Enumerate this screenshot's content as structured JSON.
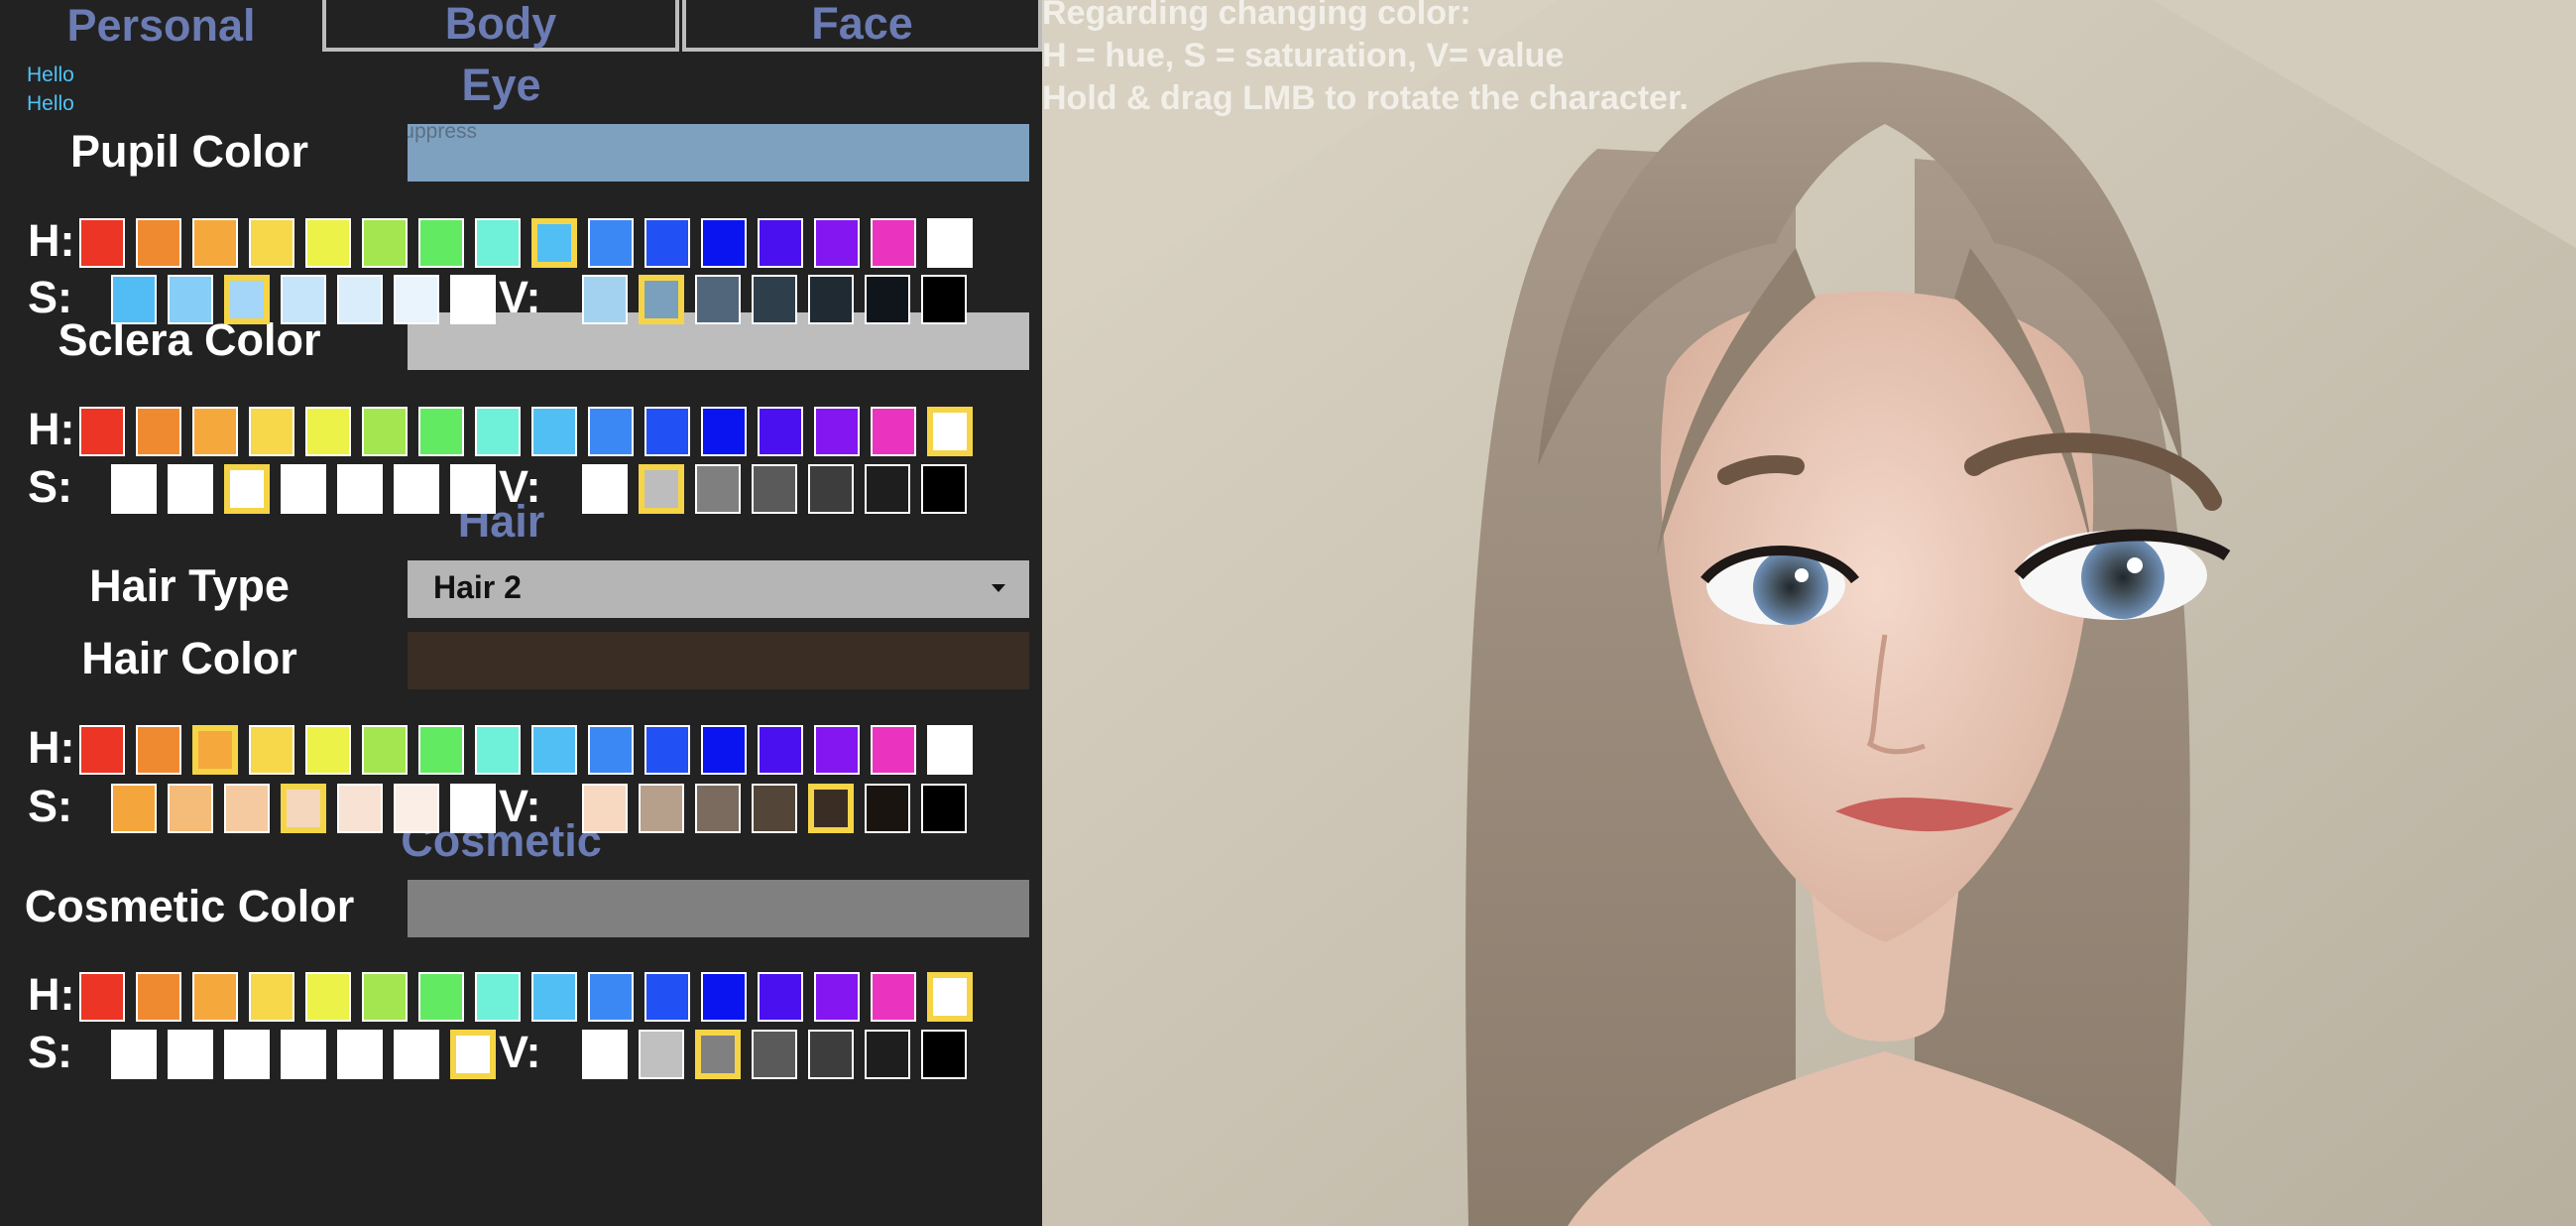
{
  "tabs": {
    "personal": "Personal",
    "body": "Body",
    "face": "Face"
  },
  "debug": {
    "line1": "Hello",
    "line2": "Hello",
    "ghost_text": "Press F to suppress"
  },
  "sections": {
    "eye": "Eye",
    "hair": "Hair",
    "cosmetic": "Cosmetic"
  },
  "labels": {
    "h": "H:",
    "s": "S:",
    "v": "V:"
  },
  "hue_palette": [
    "#ec3524",
    "#f08a30",
    "#f5a93c",
    "#f7d84a",
    "#ecf248",
    "#a4e650",
    "#63ea63",
    "#6ff0d9",
    "#52bff4",
    "#3b88f4",
    "#2150f4",
    "#0a14f0",
    "#4a10f0",
    "#8416f2",
    "#ea34bf",
    "#ffffff"
  ],
  "groups": [
    {
      "key": "pupil",
      "title": "Pupil Color",
      "bar": "#7ea1c0",
      "hue_sel": 8,
      "s": [
        "#52bdf5",
        "#86cdf7",
        "#a3d6f8",
        "#c7e5fa",
        "#d9edfb",
        "#eaf4fd",
        "#ffffff"
      ],
      "s_sel": 2,
      "v": [
        "#a3d2f0",
        "#7ba0bd",
        "#51667a",
        "#2f3e4b",
        "#1f2a33",
        "#0f151a",
        "#000000"
      ],
      "v_sel": 1
    },
    {
      "key": "sclera",
      "title": "Sclera Color",
      "bar": "#bdbdbd",
      "hue_sel": 15,
      "s": [
        "#ffffff",
        "#ffffff",
        "#ffffff",
        "#ffffff",
        "#ffffff",
        "#ffffff",
        "#ffffff"
      ],
      "s_sel": 2,
      "v": [
        "#ffffff",
        "#bdbdbd",
        "#7f7f7f",
        "#5a5a5a",
        "#3d3d3d",
        "#1e1e1e",
        "#000000"
      ],
      "v_sel": 1
    },
    {
      "key": "hair",
      "title": "Hair Color",
      "bar": "#3a2d24",
      "hue_sel": 2,
      "s": [
        "#f4a63c",
        "#f5bb78",
        "#f5caa0",
        "#f5d7bd",
        "#f7e2d3",
        "#faeee6",
        "#ffffff"
      ],
      "s_sel": 3,
      "v": [
        "#f6d9c0",
        "#b6a08b",
        "#7a6b5e",
        "#534638",
        "#3a2d24",
        "#1a1410",
        "#000000"
      ],
      "v_sel": 4
    },
    {
      "key": "cosmetic",
      "title": "Cosmetic Color",
      "bar": "#808080",
      "hue_sel": 15,
      "s": [
        "#ffffff",
        "#ffffff",
        "#ffffff",
        "#ffffff",
        "#ffffff",
        "#ffffff",
        "#ffffff"
      ],
      "s_sel": 6,
      "v": [
        "#ffffff",
        "#c0c0c0",
        "#808080",
        "#5a5a5a",
        "#3d3d3d",
        "#1e1e1e",
        "#000000"
      ],
      "v_sel": 2
    }
  ],
  "hair_type": {
    "label": "Hair Type",
    "value": "Hair 2"
  },
  "hints": {
    "line1": "Regarding changing color:",
    "line2": "H = hue, S =  saturation, V= value",
    "line3": "Hold & drag LMB to rotate the character."
  }
}
